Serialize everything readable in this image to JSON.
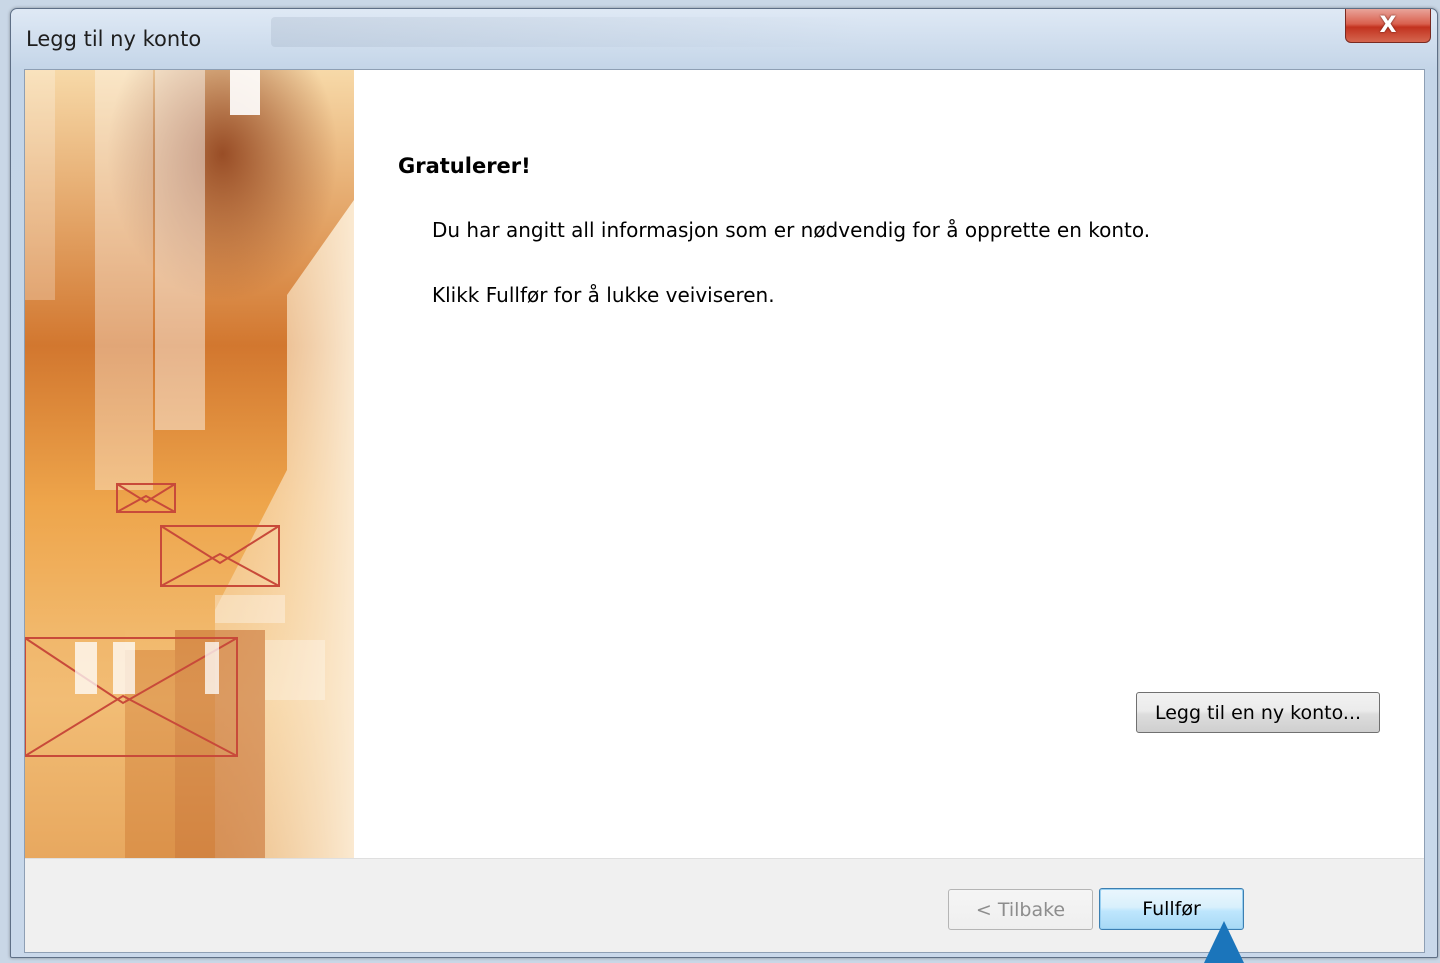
{
  "window": {
    "title": "Legg til ny konto",
    "close_label": "X"
  },
  "content": {
    "heading": "Gratulerer!",
    "line1": "Du har angitt all informasjon som er nødvendig for å opprette en konto.",
    "line2": "Klikk Fullfør for å lukke veiviseren.",
    "add_account_button": "Legg til en ny konto..."
  },
  "footer": {
    "back_button": "< Tilbake",
    "finish_button": "Fullfør"
  },
  "colors": {
    "accent_blue": "#1b75bb",
    "art_orange": "#e89a3c",
    "art_brown": "#b45a28",
    "envelope_red": "#c84a3a"
  }
}
